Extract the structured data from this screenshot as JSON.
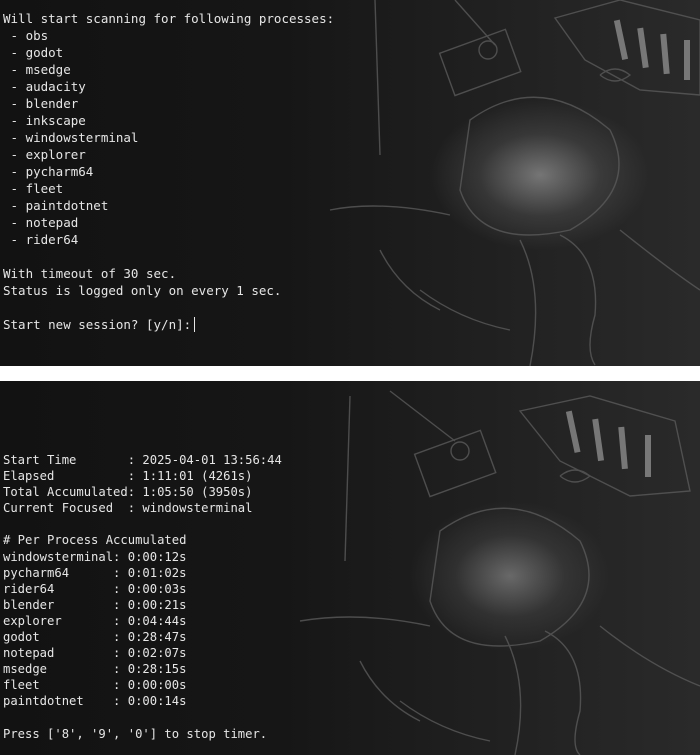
{
  "session_prompt": {
    "header": "Will start scanning for following processes:",
    "processes": [
      " - obs",
      " - godot",
      " - msedge",
      " - audacity",
      " - blender",
      " - inkscape",
      " - windowsterminal",
      " - explorer",
      " - pycharm64",
      " - fleet",
      " - paintdotnet",
      " - notepad",
      " - rider64"
    ],
    "timeout_line": "With timeout of 30 sec.",
    "status_line": "Status is logged only on every 1 sec.",
    "prompt": "Start new session? [y/n]:"
  },
  "timer_status": {
    "start_time": "Start Time       : 2025-04-01 13:56:44",
    "elapsed": "Elapsed          : 1:11:01 (4261s)",
    "total_accumulated": "Total Accumulated: 1:05:50 (3950s)",
    "current_focused": "Current Focused  : windowsterminal",
    "per_process_header": "# Per Process Accumulated",
    "per_process": [
      "windowsterminal: 0:00:12s",
      "pycharm64      : 0:01:02s",
      "rider64        : 0:00:03s",
      "blender        : 0:00:21s",
      "explorer       : 0:04:44s",
      "godot          : 0:28:47s",
      "notepad        : 0:02:07s",
      "msedge         : 0:28:15s",
      "fleet          : 0:00:00s",
      "paintdotnet    : 0:00:14s"
    ],
    "stop_hint": "Press ['8', '9', '0'] to stop timer."
  }
}
